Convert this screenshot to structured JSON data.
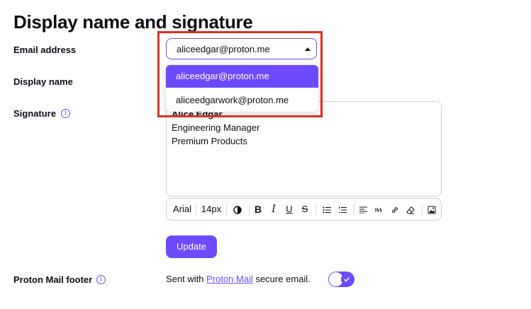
{
  "page_title": "Display name and signature",
  "email": {
    "label": "Email address",
    "selected": "aliceedgar@proton.me",
    "options": [
      "aliceedgar@proton.me",
      "aliceedgarwork@proton.me"
    ]
  },
  "display_name": {
    "label": "Display name"
  },
  "signature": {
    "label": "Signature",
    "info_icon": "i",
    "lines": [
      "Alice Edgar",
      "Engineering Manager",
      "Premium Products"
    ]
  },
  "toolbar": {
    "font": "Arial",
    "size": "14px",
    "icons": [
      "contrast-icon",
      "bold-icon",
      "italic-icon",
      "underline-icon",
      "strikethrough-icon",
      "bullet-list-icon",
      "numbered-list-icon",
      "align-left-icon",
      "quote-icon",
      "link-icon",
      "eraser-icon",
      "image-icon"
    ]
  },
  "update_button": "Update",
  "footer": {
    "label": "Proton Mail footer",
    "info_icon": "i",
    "text_before": "Sent with ",
    "link": "Proton Mail",
    "text_after": " secure email.",
    "enabled": true
  },
  "colors": {
    "accent": "#6d4aff",
    "highlight": "#e02d22"
  }
}
